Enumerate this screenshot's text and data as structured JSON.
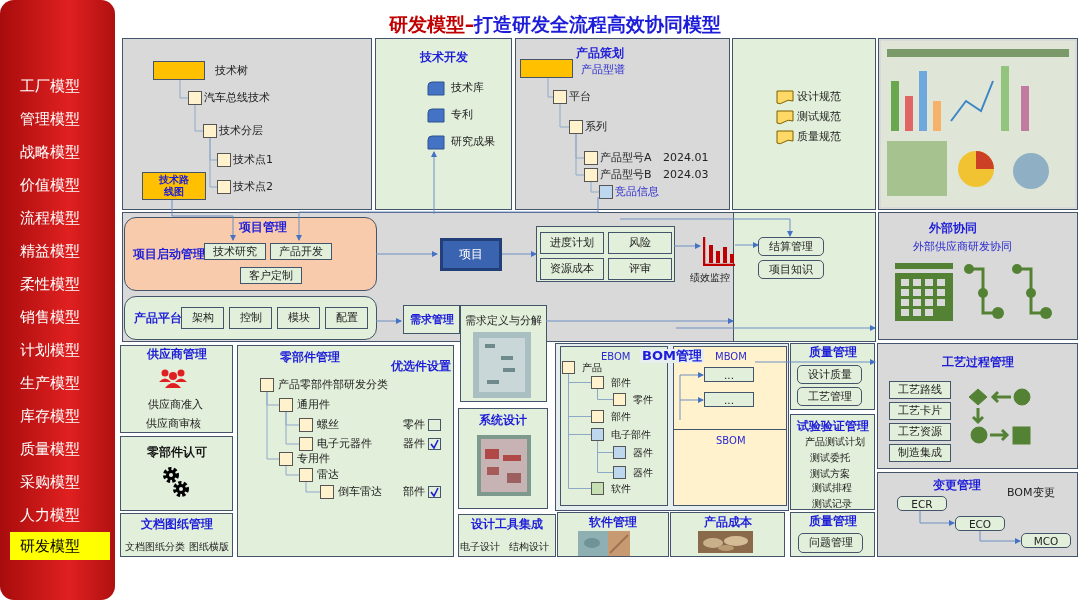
{
  "sidebar": {
    "items": [
      {
        "label": "工厂模型",
        "selected": false
      },
      {
        "label": "管理模型",
        "selected": false
      },
      {
        "label": "战略模型",
        "selected": false
      },
      {
        "label": "价值模型",
        "selected": false
      },
      {
        "label": "流程模型",
        "selected": false
      },
      {
        "label": "精益模型",
        "selected": false
      },
      {
        "label": "柔性模型",
        "selected": false
      },
      {
        "label": "销售模型",
        "selected": false
      },
      {
        "label": "计划模型",
        "selected": false
      },
      {
        "label": "生产模型",
        "selected": false
      },
      {
        "label": "库存模型",
        "selected": false
      },
      {
        "label": "质量模型",
        "selected": false
      },
      {
        "label": "采购模型",
        "selected": false
      },
      {
        "label": "人力模型",
        "selected": false
      },
      {
        "label": "研发模型",
        "selected": true
      }
    ]
  },
  "title": {
    "highlight": "研发模型–",
    "rest": "打造研发全流程高效协同模型"
  },
  "tech_tree": {
    "label": "技术树",
    "roadmap": "技术路线图",
    "children": [
      {
        "label": "汽车总线技术",
        "children": [
          {
            "label": "技术分层",
            "children": [
              {
                "label": "技术点1"
              },
              {
                "label": "技术点2"
              }
            ]
          }
        ]
      }
    ]
  },
  "tech_development": {
    "title": "技术开发",
    "items": [
      "技术库",
      "专利",
      "研究成果"
    ]
  },
  "product_planning": {
    "title": "产品策划",
    "label": "产品型谱",
    "children": [
      {
        "label": "平台",
        "kind": "plain",
        "children": [
          {
            "label": "系列",
            "kind": "plain",
            "children": [
              {
                "label": "产品型号A",
                "kind": "plain",
                "date": "2024.01"
              },
              {
                "label": "产品型号B",
                "kind": "plain",
                "date": "2024.03",
                "children": [
                  {
                    "label": "竞品信息",
                    "kind": "reference"
                  }
                ]
              }
            ]
          }
        ]
      }
    ]
  },
  "standards": {
    "items": [
      "设计规范",
      "测试规范",
      "质量规范"
    ]
  },
  "project_management": {
    "title": "项目管理",
    "start_label": "项目启动管理",
    "start_items": [
      "技术研究",
      "产品开发",
      "客户定制"
    ],
    "project": "项目",
    "controls": [
      "进度计划",
      "风险",
      "资源成本",
      "评审"
    ],
    "monitoring": "绩效监控",
    "extras": [
      "结算管理",
      "项目知识"
    ]
  },
  "product_platform": {
    "label": "产品平台",
    "items": [
      "架构",
      "控制",
      "模块",
      "配置"
    ]
  },
  "requirements": {
    "title": "需求管理",
    "decomposition": "需求定义与分解"
  },
  "external": {
    "title": "外部协同",
    "subtitle": "外部供应商研发协同"
  },
  "supplier": {
    "title": "供应商管理",
    "items": [
      "供应商准入",
      "供应商审核"
    ]
  },
  "parts_approval": {
    "title": "零部件认可"
  },
  "documents": {
    "title": "文档图纸管理",
    "items": [
      "文档图纸分类",
      "图纸横版"
    ]
  },
  "parts": {
    "title": "零部件管理",
    "preferred_title": "优选件设置",
    "tree": [
      {
        "label": "产品零部件部研发分类",
        "children": [
          {
            "label": "通用件",
            "children": [
              {
                "label": "螺丝",
                "preferred": {
                  "label": "零件",
                  "checked": false
                }
              },
              {
                "label": "电子元器件",
                "preferred": {
                  "label": "器件",
                  "checked": true
                }
              }
            ]
          },
          {
            "label": "专用件",
            "children": [
              {
                "label": "雷达",
                "children": [
                  {
                    "label": "倒车雷达",
                    "preferred": {
                      "label": "部件",
                      "checked": true
                    }
                  }
                ]
              }
            ]
          }
        ]
      }
    ]
  },
  "system_design": {
    "title": "系统设计"
  },
  "design_tools": {
    "title": "设计工具集成",
    "items": [
      "电子设计",
      "结构设计"
    ]
  },
  "bom": {
    "title": "BOM管理",
    "ebom": {
      "label": "EBOM",
      "tree": [
        {
          "label": "产品",
          "kind": "assembly",
          "children": [
            {
              "label": "部件",
              "kind": "assembly",
              "children": [
                {
                  "label": "零件",
                  "kind": "assembly"
                }
              ]
            },
            {
              "label": "部件",
              "kind": "assembly"
            },
            {
              "label": "电子部件",
              "kind": "electronic",
              "children": [
                {
                  "label": "器件",
                  "kind": "electronic"
                },
                {
                  "label": "器件",
                  "kind": "electronic"
                }
              ]
            },
            {
              "label": "软件",
              "kind": "software"
            }
          ]
        }
      ]
    },
    "mbom": {
      "label": "MBOM",
      "items": [
        "...",
        "..."
      ]
    },
    "sbom": {
      "label": "SBOM"
    }
  },
  "software": {
    "title": "软件管理"
  },
  "cost": {
    "title": "产品成本"
  },
  "quality": {
    "title": "质量管理",
    "items": [
      "设计质量",
      "工艺管理"
    ]
  },
  "testing": {
    "title": "试验验证管理",
    "items": [
      "产品测试计划",
      "测试委托",
      "测试方案",
      "测试排程",
      "测试记录"
    ]
  },
  "quality_issues": {
    "title": "质量管理",
    "items": [
      "问题管理"
    ]
  },
  "process": {
    "title": "工艺过程管理",
    "items": [
      "工艺路线",
      "工艺卡片",
      "工艺资源",
      "制造集成"
    ]
  },
  "change": {
    "title": "变更管理",
    "label": "BOM变更",
    "items": [
      "ECR",
      "ECO",
      "MCO"
    ]
  }
}
